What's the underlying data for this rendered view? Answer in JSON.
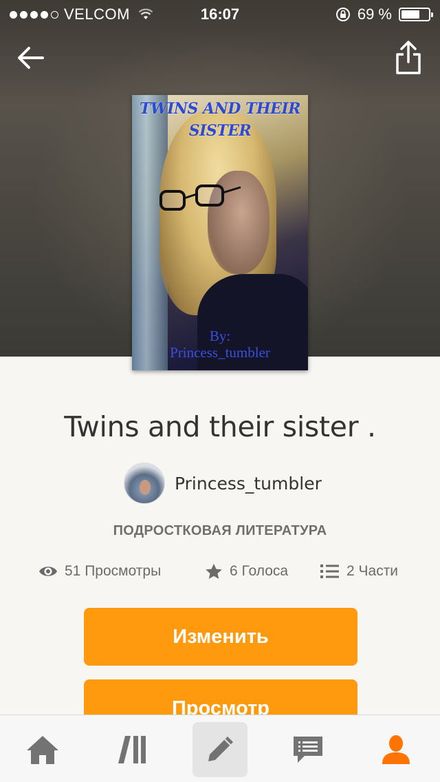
{
  "status_bar": {
    "signal_bars": 4,
    "carrier": "VELCOM",
    "time": "16:07",
    "battery_percent": "69 %",
    "battery_level": 0.69
  },
  "nav": {
    "back_icon": "arrow-left-icon",
    "share_icon": "share-icon"
  },
  "cover": {
    "title": "TWINS AND THEIR SISTER",
    "byline_1": "By:",
    "byline_2": "Princess_tumbler"
  },
  "story": {
    "title": "Twins and their sister .",
    "author": "Princess_tumbler",
    "category": "ПОДРОСТКОВАЯ ЛИТЕРАТУРА"
  },
  "stats": {
    "views": "51 Просмотры",
    "votes": "6 Голоса",
    "parts": "2 Части"
  },
  "buttons": {
    "edit_label": "Изменить",
    "view_label": "Просмотр"
  },
  "tab_bar": {
    "items": [
      {
        "icon": "home-icon"
      },
      {
        "icon": "library-icon"
      },
      {
        "icon": "pencil-icon"
      },
      {
        "icon": "messages-icon"
      },
      {
        "icon": "profile-icon"
      }
    ]
  },
  "colors": {
    "accent": "#ff9a0e",
    "tab_icon": "#737373",
    "tab_active": "#ff7300",
    "cover_title": "#2d4bd0"
  }
}
